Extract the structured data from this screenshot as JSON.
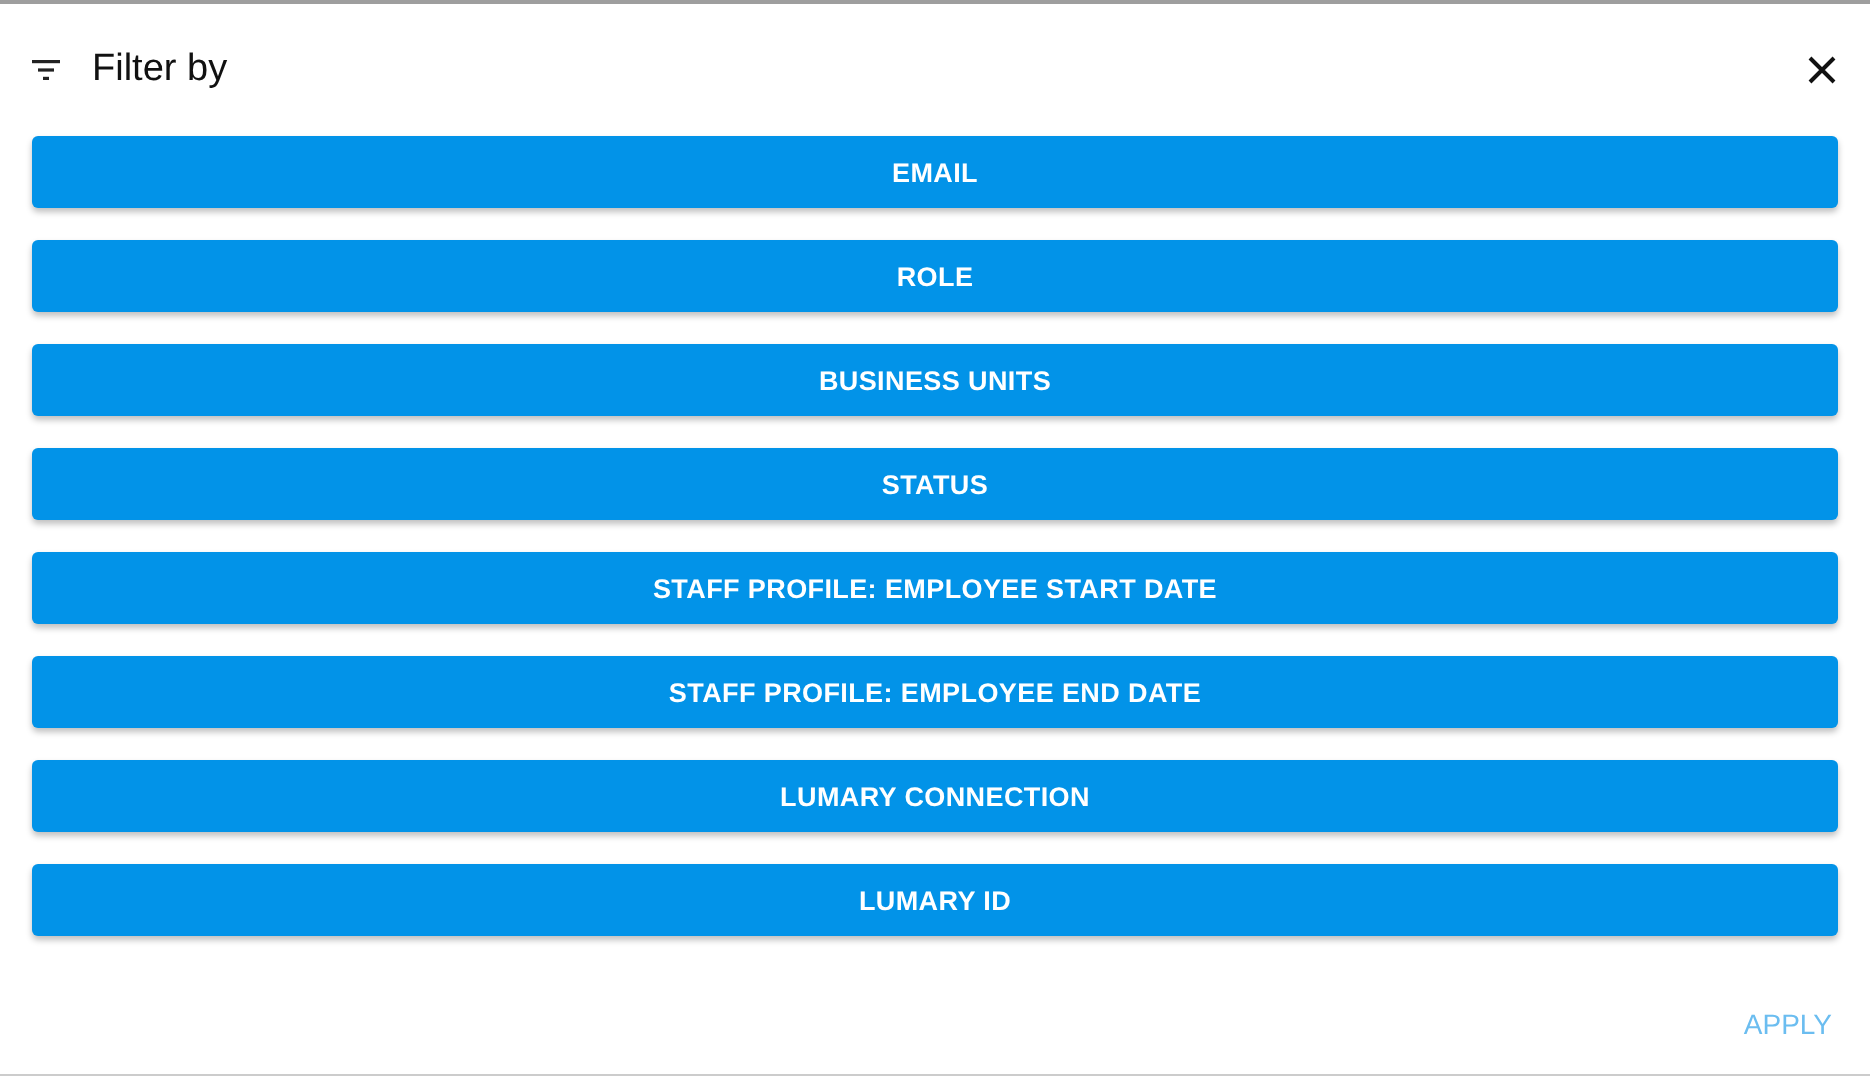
{
  "dialog": {
    "title": "Filter by"
  },
  "filters": [
    "EMAIL",
    "ROLE",
    "BUSINESS UNITS",
    "STATUS",
    "STAFF PROFILE: EMPLOYEE START DATE",
    "STAFF PROFILE: EMPLOYEE END DATE",
    "LUMARY CONNECTION",
    "LUMARY ID"
  ],
  "apply_button": {
    "label": "APPLY",
    "disabled": true
  }
}
